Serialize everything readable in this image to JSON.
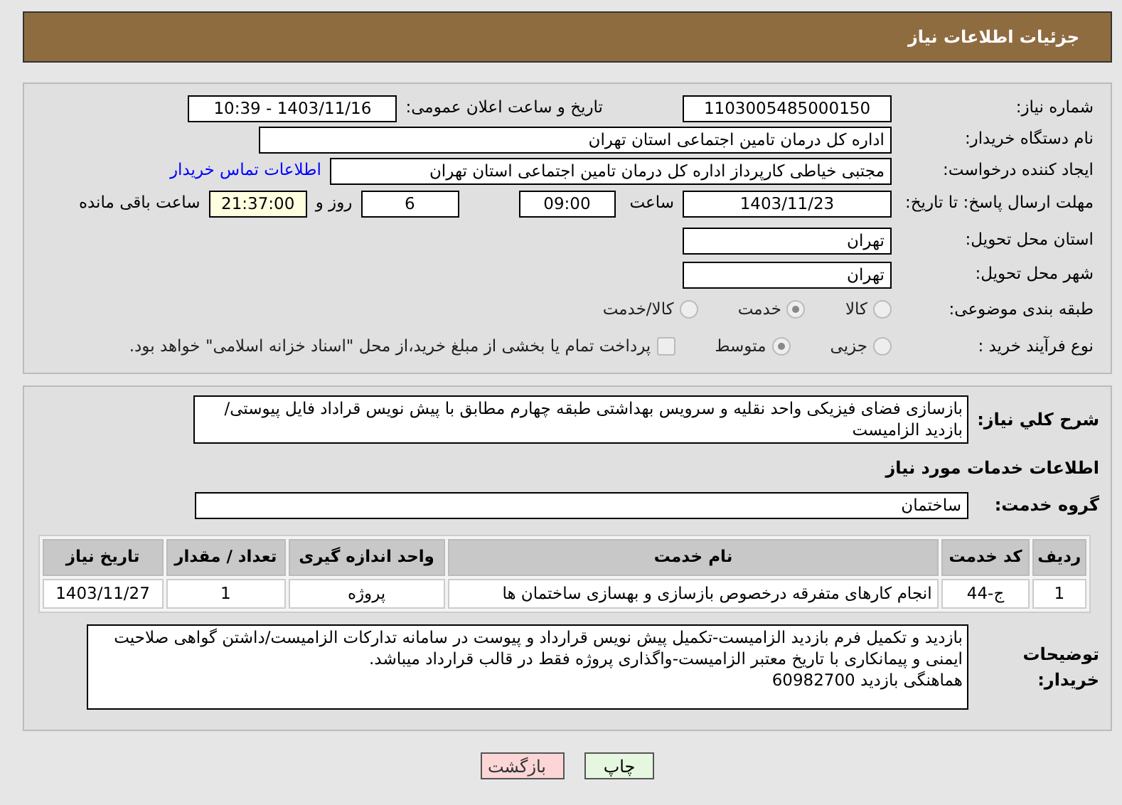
{
  "header": {
    "title": "جزئیات اطلاعات نیاز"
  },
  "need_number": {
    "label": "شماره نیاز:",
    "value": "1103005485000150"
  },
  "announce": {
    "label": "تاریخ و ساعت اعلان عمومی:",
    "value": "1403/11/16 - 10:39"
  },
  "buyer_org": {
    "label": "نام دستگاه خریدار:",
    "value": "اداره کل درمان تامین اجتماعی استان تهران"
  },
  "requester": {
    "label": "ایجاد کننده درخواست:",
    "value": "مجتبی خیاطی کارپرداز اداره کل درمان تامین اجتماعی استان تهران",
    "link": "اطلاعات تماس خریدار"
  },
  "deadline": {
    "label": "مهلت ارسال پاسخ: تا تاریخ:",
    "date": "1403/11/23",
    "time_label": "ساعت",
    "time": "09:00",
    "days": "6",
    "days_label": "روز و",
    "remaining": "21:37:00",
    "remaining_label": "ساعت باقی مانده"
  },
  "province": {
    "label": "استان محل تحویل:",
    "value": "تهران"
  },
  "city": {
    "label": "شهر محل تحویل:",
    "value": "تهران"
  },
  "category": {
    "label": "طبقه بندی موضوعی:",
    "options": [
      {
        "label": "کالا",
        "selected": false
      },
      {
        "label": "خدمت",
        "selected": true
      },
      {
        "label": "کالا/خدمت",
        "selected": false
      }
    ]
  },
  "purchase_type": {
    "label": "نوع فرآیند خرید :",
    "options": [
      {
        "label": "جزیی",
        "selected": false
      },
      {
        "label": "متوسط",
        "selected": true
      }
    ],
    "payment": {
      "label": "پرداخت تمام یا بخشی از مبلغ خرید،از محل \"اسناد خزانه اسلامی\" خواهد بود.",
      "checked": false
    }
  },
  "description": {
    "label": "شرح کلي نياز:",
    "value": "بازسازی فضای فیزیکی واحد نقلیه و سرویس بهداشتی طبقه چهارم مطابق با پیش نویس قراداد فایل پیوستی/بازدید الزامیست"
  },
  "services_heading": "اطلاعات خدمات مورد نياز",
  "service_group": {
    "label": "گروه خدمت:",
    "value": "ساختمان"
  },
  "table": {
    "columns": [
      "ردیف",
      "کد خدمت",
      "نام خدمت",
      "واحد اندازه گیری",
      "تعداد / مقدار",
      "تاریخ نیاز"
    ],
    "rows": [
      [
        "1",
        "ج-44",
        "انجام کارهای متفرقه درخصوص بازسازی و بهسازی ساختمان ها",
        "پروژه",
        "1",
        "1403/11/27"
      ]
    ]
  },
  "buyer_notes": {
    "label": "توضیحات خریدار:",
    "value": "بازدید و تکمیل فرم بازدید الزامیست-تکمیل پیش نویس قرارداد و پیوست در سامانه تدارکات الزامیست/داشتن گواهی صلاحیت ایمنی و پیمانکاری با تاریخ معتبر الزامیست-واگذاری پروژه فقط در قالب قرارداد میباشد.\nهماهنگی بازدید 60982700"
  },
  "buttons": [
    {
      "label": "چاپ",
      "kind": "print"
    },
    {
      "label": "بازگشت",
      "kind": "back"
    }
  ]
}
